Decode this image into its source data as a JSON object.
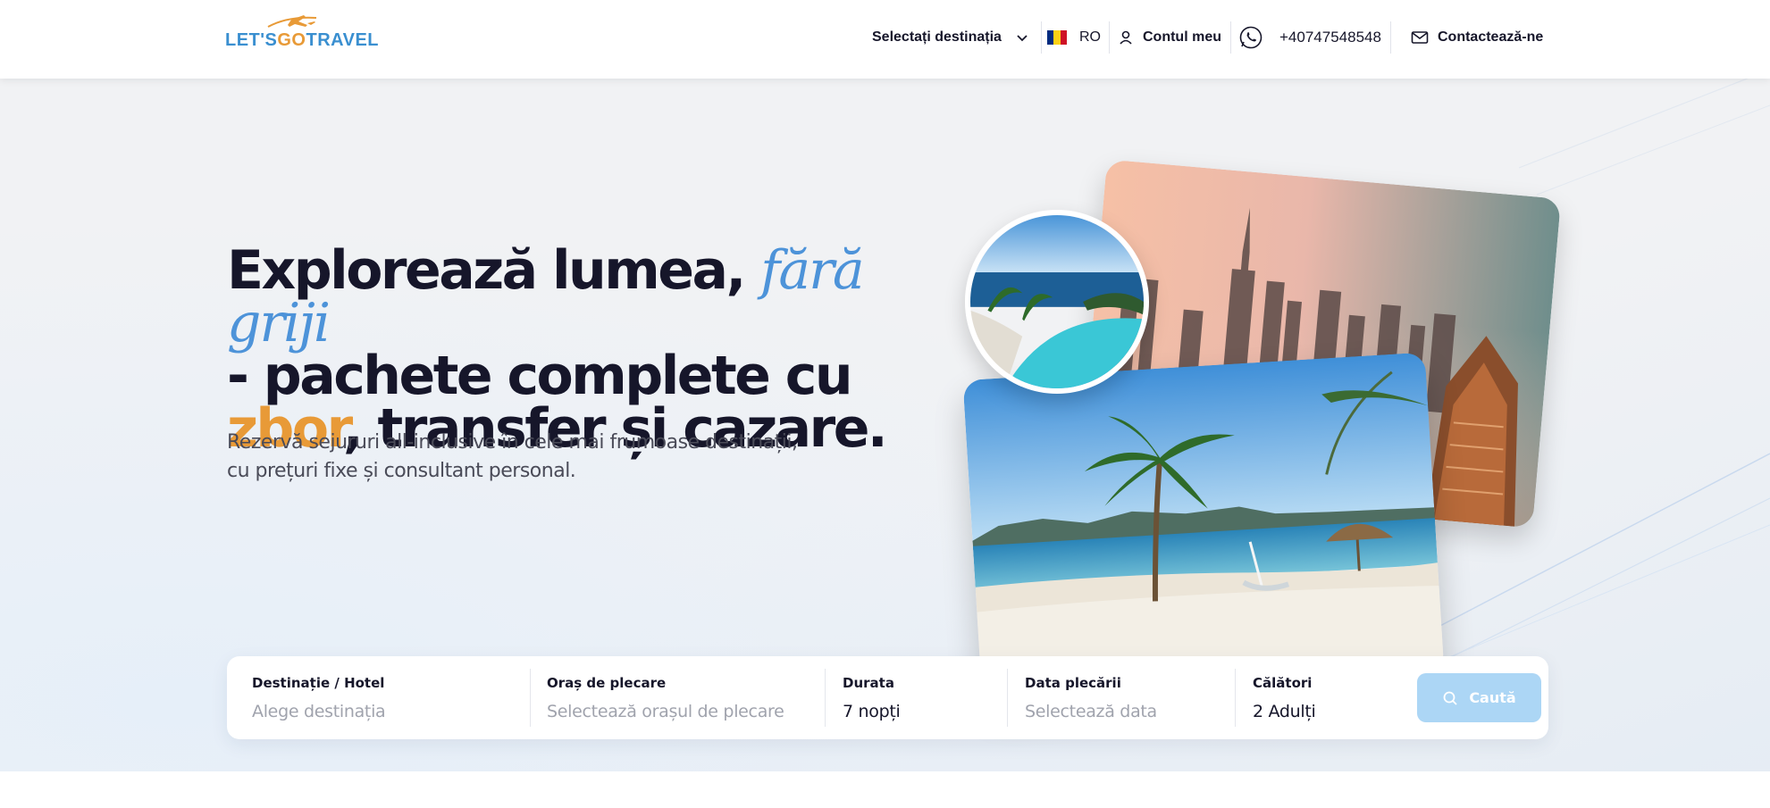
{
  "header": {
    "logo": {
      "lets": "LET'S",
      "go": "GO",
      "travel": "TRAVEL"
    },
    "destination_select": "Selectați destinația",
    "language": "RO",
    "account": "Contul meu",
    "phone": "+40747548548",
    "contact": "Contactează-ne",
    "flag_colors": [
      "#002b7f",
      "#fcd116",
      "#ce1126"
    ]
  },
  "hero": {
    "headline": {
      "part1": "Explorează lumea, ",
      "accent_blue": "fără griji",
      "part2": "- pachete complete cu",
      "accent_orange": "zbor",
      "part3": ", transfer și cazare."
    },
    "subtitle": "Rezervă sejururi all-inclusive în cele mai frumoase destinații, cu prețuri fixe și consultant personal."
  },
  "search": {
    "destination": {
      "label": "Destinație / Hotel",
      "placeholder": "Alege destinația"
    },
    "departure_city": {
      "label": "Oraș de plecare",
      "placeholder": "Selectează orașul de plecare"
    },
    "duration": {
      "label": "Durata",
      "value": "7 nopți"
    },
    "departure_date": {
      "label": "Data plecării",
      "placeholder": "Selectează data"
    },
    "travelers": {
      "label": "Călători",
      "value": "2 Adulți"
    },
    "button": "Caută"
  },
  "colors": {
    "accent_blue": "#4d93d9",
    "accent_orange": "#e89a37",
    "button_bg": "#acd6f5",
    "text_dark": "#16162a"
  }
}
